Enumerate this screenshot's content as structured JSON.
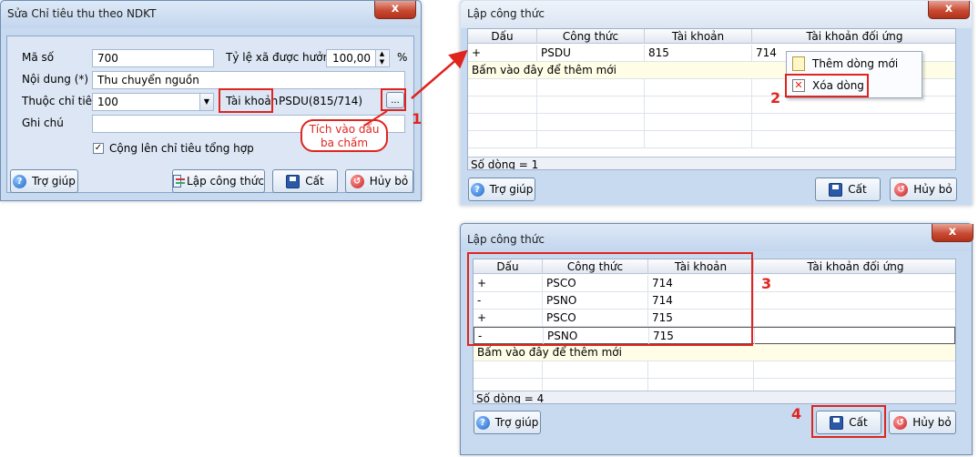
{
  "dialog1": {
    "title": "Sửa Chỉ tiêu thu theo NDKT",
    "close_glyph": "x",
    "ma_so_label": "Mã số",
    "ma_so_value": "700",
    "ty_le_label": "Tỷ lệ xã được hưởng",
    "ty_le_value": "100,00",
    "percent": "%",
    "noi_dung_label": "Nội dung (*)",
    "noi_dung_value": "Thu chuyển nguồn",
    "thuoc_chi_tieu_label": "Thuộc chỉ tiêu",
    "thuoc_chi_tieu_value": "100",
    "tai_khoan_label": "Tài khoản",
    "tai_khoan_value": "PSDU(815/714)",
    "ellipsis": "...",
    "ghi_chu_label": "Ghi chú",
    "ghi_chu_value": "",
    "checkbox_label": "Cộng lên chỉ tiêu tổng hợp",
    "checkbox_checked": true,
    "buttons": {
      "help": "Trợ giúp",
      "formula": "Lập công thức",
      "save": "Cất",
      "cancel": "Hủy bỏ"
    },
    "callout": "Tích vào dấu ba chấm"
  },
  "dialog2": {
    "title": "Lập công thức",
    "close_glyph": "x",
    "columns": [
      "Dấu",
      "Công thức",
      "Tài khoản",
      "Tài khoản đối ứng"
    ],
    "rows": [
      {
        "dau": "+",
        "cong_thuc": "PSDU",
        "tai_khoan": "815",
        "doi_ung": "714"
      }
    ],
    "new_row": "Bấm vào đây để thêm mới",
    "footer": "Số dòng = 1",
    "context_menu": [
      "Thêm dòng mới",
      "Xóa dòng"
    ],
    "buttons": {
      "help": "Trợ giúp",
      "save": "Cất",
      "cancel": "Hủy bỏ"
    }
  },
  "dialog3": {
    "title": "Lập công thức",
    "close_glyph": "x",
    "columns": [
      "Dấu",
      "Công thức",
      "Tài khoản",
      "Tài khoản đối ứng"
    ],
    "rows": [
      {
        "dau": "+",
        "cong_thuc": "PSCO",
        "tai_khoan": "714",
        "doi_ung": ""
      },
      {
        "dau": "-",
        "cong_thuc": "PSNO",
        "tai_khoan": "714",
        "doi_ung": ""
      },
      {
        "dau": "+",
        "cong_thuc": "PSCO",
        "tai_khoan": "715",
        "doi_ung": ""
      },
      {
        "dau": "-",
        "cong_thuc": "PSNO",
        "tai_khoan": "715",
        "doi_ung": ""
      }
    ],
    "new_row": "Bấm vào đây để thêm mới",
    "footer": "Số dòng = 4",
    "buttons": {
      "help": "Trợ giúp",
      "save": "Cất",
      "cancel": "Hủy bỏ"
    }
  },
  "steps": [
    "1",
    "2",
    "3",
    "4"
  ],
  "colors": {
    "highlight": "#e0241e"
  }
}
